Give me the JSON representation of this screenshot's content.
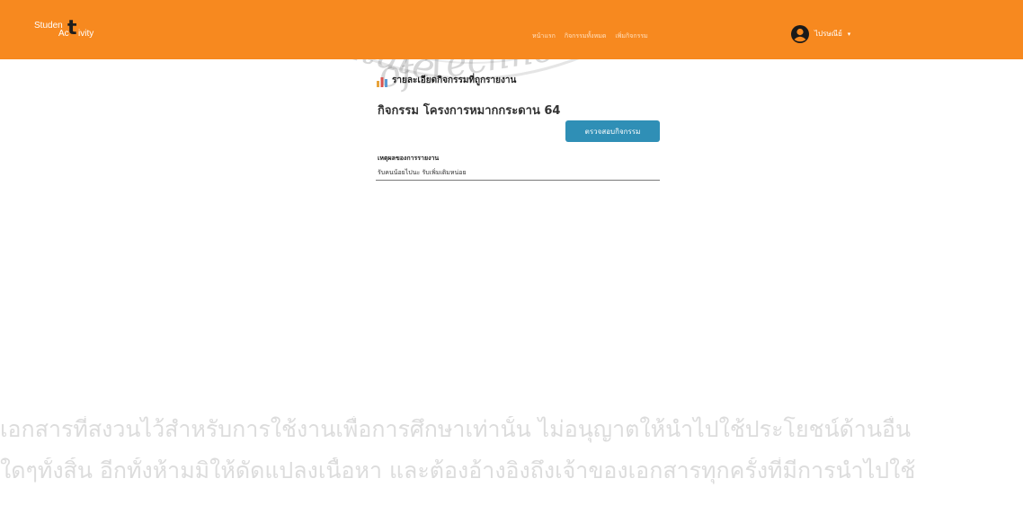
{
  "navbar": {
    "brand_parts": [
      "Studen",
      "Ac",
      "ivity"
    ],
    "brand_accent": "t",
    "links": [
      "หน้าแรก",
      "กิจกรรมทั้งหมด",
      "เพิ่มกิจกรรม"
    ],
    "user_name": "ไปรษณีย์",
    "bg_color": "#f7891f"
  },
  "main": {
    "section_title": "รายละเอียดกิจกรรมที่ถูกรายงาน",
    "activity_label": "กิจกรรม",
    "activity_name": "โครงการหมากกระดาน 64",
    "check_button_label": "ตรวจสอบกิจกรรม",
    "reason_label": "เหตุผลของการรายงาน",
    "reason_value": "รับคนน้อยไปนะ รับเพิ่มเติมหน่อย"
  },
  "watermark": {
    "arc_text_1": "Institute",
    "arc_text_2": "of Techno",
    "line_1": "เอกสารที่สงวนไว้สำหรับการใช้งานเพื่อการศึกษาเท่านั้น ไม่อนุญาตให้นำไปใช้ประโยชน์ด้านอื่น",
    "line_2": "ใดๆทั้งสิ้น อีกทั้งห้ามมิให้ดัดแปลงเนื้อหา และต้องอ้างอิงถึงเจ้าของเอกสารทุกครั้งที่มีการนำไปใช้"
  },
  "icons": {
    "user": "user-circle-icon",
    "caret": "caret-down-icon",
    "chart": "bar-chart-icon"
  },
  "colors": {
    "accent": "#f7891f",
    "button": "#2f8fb6"
  }
}
